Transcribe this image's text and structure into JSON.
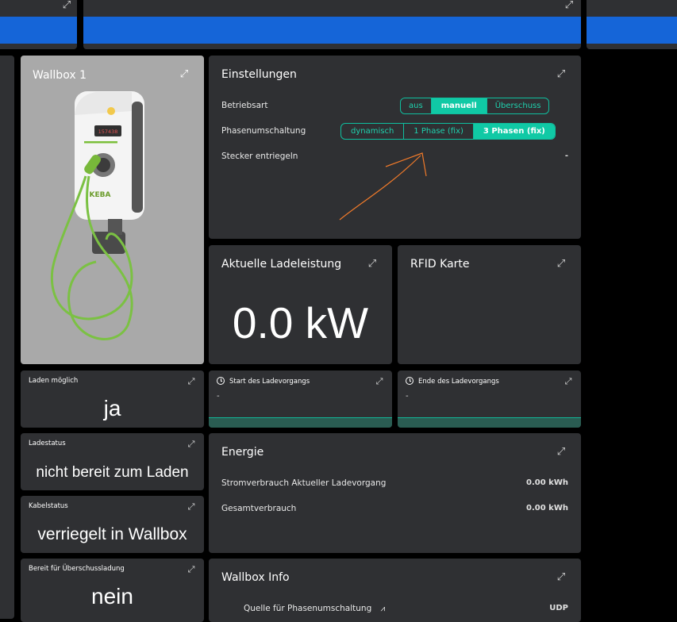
{
  "top_row": {
    "expand_icon": "expand-icon"
  },
  "wallbox": {
    "title": "Wallbox 1",
    "device_display": "157438",
    "brand": "KEBA"
  },
  "settings": {
    "title": "Einstellungen",
    "betriebsart_label": "Betriebsart",
    "betriebsart_options": [
      "aus",
      "manuell",
      "Überschuss"
    ],
    "betriebsart_selected": "manuell",
    "phasen_label": "Phasenumschaltung",
    "phasen_options": [
      "dynamisch",
      "1 Phase (fix)",
      "3 Phasen (fix)"
    ],
    "phasen_selected": "3 Phasen (fix)",
    "stecker_label": "Stecker entriegeln",
    "stecker_value": "-"
  },
  "ladeleistung": {
    "title": "Aktuelle Ladeleistung",
    "value": "0.0 kW"
  },
  "rfid": {
    "title": "RFID Karte"
  },
  "laden_moeglich": {
    "title": "Laden möglich",
    "value": "ja"
  },
  "start": {
    "title": "Start des Ladevorgangs",
    "value": "-"
  },
  "ende": {
    "title": "Ende des Ladevorgangs",
    "value": "-"
  },
  "ladestatus": {
    "title": "Ladestatus",
    "value": "nicht bereit zum Laden"
  },
  "kabelstatus": {
    "title": "Kabelstatus",
    "value": "verriegelt in Wallbox"
  },
  "ueberschuss": {
    "title": "Bereit für Überschussladung",
    "value": "nein"
  },
  "energie": {
    "title": "Energie",
    "rows": [
      {
        "label": "Stromverbrauch Aktueller Ladevorgang",
        "value": "0.00 kWh"
      },
      {
        "label": "Gesamtverbrauch",
        "value": "0.00 kWh"
      }
    ]
  },
  "wallbox_info": {
    "title": "Wallbox Info",
    "row_label": "Quelle für Phasenumschaltung",
    "row_value": "UDP"
  },
  "colors": {
    "accent": "#10c9a5",
    "card_bg": "#2f3033",
    "top_blue": "#1565d8",
    "annotation": "#f07a2a"
  }
}
